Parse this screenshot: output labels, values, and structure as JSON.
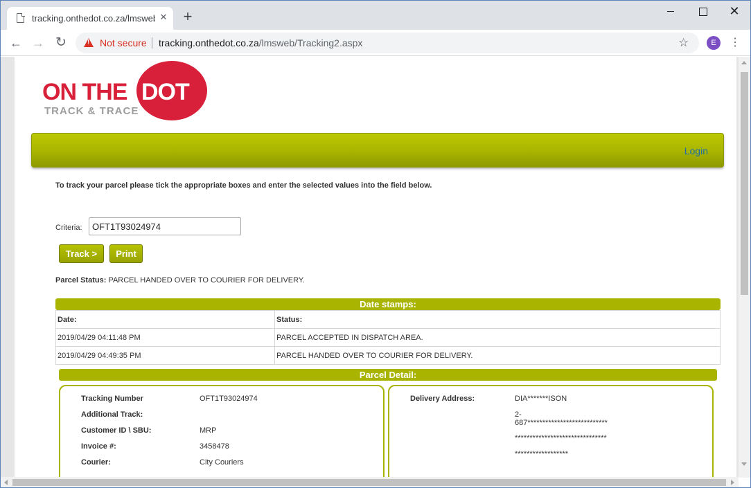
{
  "browser": {
    "tab_title": "tracking.onthedot.co.za/lmsweb/",
    "tab_close": "✕",
    "new_tab": "+",
    "close_window": "✕",
    "security_label": "Not secure",
    "url_host": "tracking.onthedot.co.za",
    "url_path": "/lmsweb/Tracking2.aspx",
    "profile_initial": "E",
    "icons": [
      "page-icon",
      "back-arrow-icon",
      "forward-arrow-icon",
      "reload-icon",
      "warning-icon",
      "star-icon",
      "kebab-menu-icon"
    ]
  },
  "logo": {
    "line1_a": "ON THE",
    "line1_b": "DOT",
    "line2": "TRACK & TRACE",
    "color": "#d9203a"
  },
  "nav": {
    "login": "Login",
    "bar_color": "#a8b400"
  },
  "form": {
    "instructions": "To track your parcel please tick the appropriate boxes and enter the selected values into the field below.",
    "criteria_label": "Criteria:",
    "criteria_value": "OFT1T93024974",
    "track_button": "Track >",
    "print_button": "Print"
  },
  "status": {
    "label": "Parcel Status:",
    "value": "PARCEL HANDED OVER TO COURIER FOR DELIVERY."
  },
  "date_stamps": {
    "title": "Date stamps:",
    "headers": [
      "Date:",
      "Status:"
    ],
    "rows": [
      [
        "2019/04/29 04:11:48 PM",
        "PARCEL ACCEPTED IN DISPATCH AREA."
      ],
      [
        "2019/04/29 04:49:35 PM",
        "PARCEL HANDED OVER TO COURIER FOR DELIVERY."
      ]
    ]
  },
  "parcel_detail": {
    "title": "Parcel Detail:",
    "left": [
      {
        "label": "Tracking Number",
        "value": "OFT1T93024974"
      },
      {
        "label": "Additional Track:",
        "value": ""
      },
      {
        "label": "Customer ID \\ SBU:",
        "value": "MRP"
      },
      {
        "label": "Invoice #:",
        "value": "3458478"
      },
      {
        "label": "Courier:",
        "value": "City Couriers"
      }
    ],
    "right": {
      "label": "Delivery Address:",
      "lines": [
        "DIA*******ISON",
        "2-",
        "687***************************",
        "*******************************",
        "******************"
      ]
    }
  }
}
